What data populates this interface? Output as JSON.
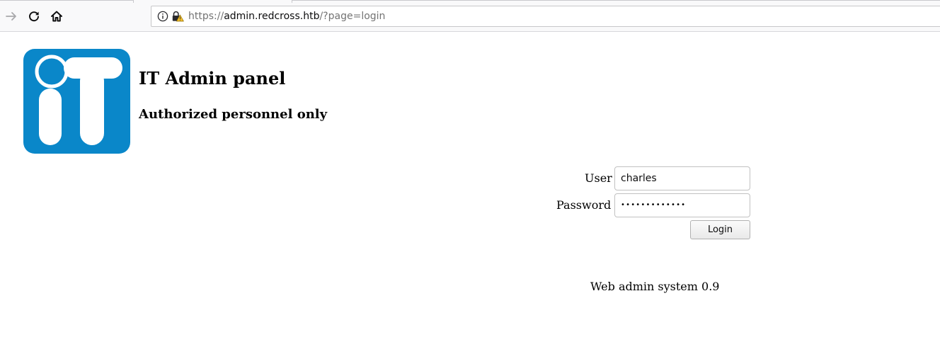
{
  "browser": {
    "url": {
      "protocol": "https://",
      "subdomain": "admin.",
      "host": "redcross.htb",
      "path": "/?page=login"
    },
    "icons": {
      "back": "arrow-right-icon",
      "reload": "reload-icon",
      "home": "home-icon",
      "info": "info-icon",
      "lock": "insecure-lock-icon"
    }
  },
  "header": {
    "logo_icon": "it-logo",
    "title": "IT Admin panel",
    "subtitle": "Authorized personnel only"
  },
  "login_form": {
    "user_label": "User",
    "user_value": "charles",
    "password_label": "Password",
    "password_mask": "•••••••••••••",
    "submit_label": "Login"
  },
  "footer": {
    "text": "Web admin system 0.9"
  },
  "colors": {
    "logo_blue": "#0a87c9",
    "page_background": "#ffffff",
    "toolbar_background": "#f9f9fa"
  }
}
